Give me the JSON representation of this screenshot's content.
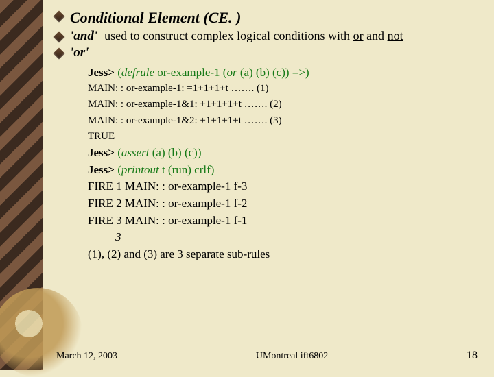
{
  "bullets": {
    "title": "Conditional Element (CE. )",
    "and_kw": "'and'",
    "and_desc_pre": "used to construct complex logical conditions with ",
    "and_desc_or": "or",
    "and_desc_mid": " and ",
    "and_desc_not": "not",
    "or_kw": "'or'"
  },
  "code": {
    "l1_a": "Jess> ",
    "l1_b": "(",
    "l1_c": "defrule",
    "l1_d": " or-example-1 (",
    "l1_e": "or",
    "l1_f": " (a) (b) (c)) =>)",
    "s1": "MAIN: : or-example-1: =1+1+1+t       ……. (1)",
    "s2": "MAIN: : or-example-1&1: +1+1+1+t   ……. (2)",
    "s3": "MAIN: : or-example-1&2: +1+1+1+t   ……. (3)",
    "s4": "TRUE",
    "l2_a": "Jess> ",
    "l2_b": "(",
    "l2_c": "assert ",
    "l2_d": "(a) (b) (c))",
    "l3_a": "Jess> ",
    "l3_b": "(",
    "l3_c": "printout ",
    "l3_d": "t (run) crlf)",
    "f1": "FIRE 1 MAIN: : or-example-1 f-3",
    "f2": "FIRE 2 MAIN: : or-example-1 f-2",
    "f3": "FIRE 3 MAIN: : or-example-1 f-1",
    "n3": "3",
    "note": "(1), (2) and (3) are 3 separate sub-rules"
  },
  "footer": {
    "date": "March 12, 2003",
    "center": "UMontreal ift6802",
    "page": "18"
  }
}
